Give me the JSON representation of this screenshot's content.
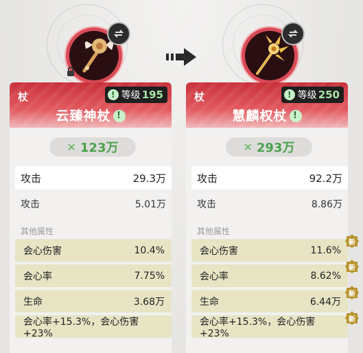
{
  "left": {
    "type_label": "杖",
    "level_label": "等级",
    "level_value": "195",
    "name": "云臻神杖",
    "power": "123万",
    "attack": {
      "label": "攻击",
      "value": "29.3万"
    },
    "defense": {
      "label": "攻击",
      "value": "5.01万"
    },
    "other_title": "其他属性",
    "attrs": [
      {
        "label": "会心伤害",
        "value": "10.4%"
      },
      {
        "label": "会心率",
        "value": "7.75%"
      },
      {
        "label": "生命",
        "value": "3.68万"
      },
      {
        "label": "会心率+15.3%，会心伤害+23%",
        "value": ""
      }
    ]
  },
  "right": {
    "type_label": "杖",
    "level_label": "等级",
    "level_value": "250",
    "name": "慧麟权杖",
    "power": "293万",
    "attack": {
      "label": "攻击",
      "value": "92.2万"
    },
    "defense": {
      "label": "攻击",
      "value": "8.86万"
    },
    "other_title": "其他属性",
    "attrs": [
      {
        "label": "会心伤害",
        "value": "11.6%"
      },
      {
        "label": "会心率",
        "value": "8.62%"
      },
      {
        "label": "生命",
        "value": "6.44万"
      },
      {
        "label": "会心率+15.3%，会心伤害+23%",
        "value": ""
      }
    ],
    "new_badge": "新"
  },
  "colors": {
    "header_red": "#c9303a",
    "power_green": "#4aa24e",
    "attr_bg": "#e7e4c4"
  }
}
